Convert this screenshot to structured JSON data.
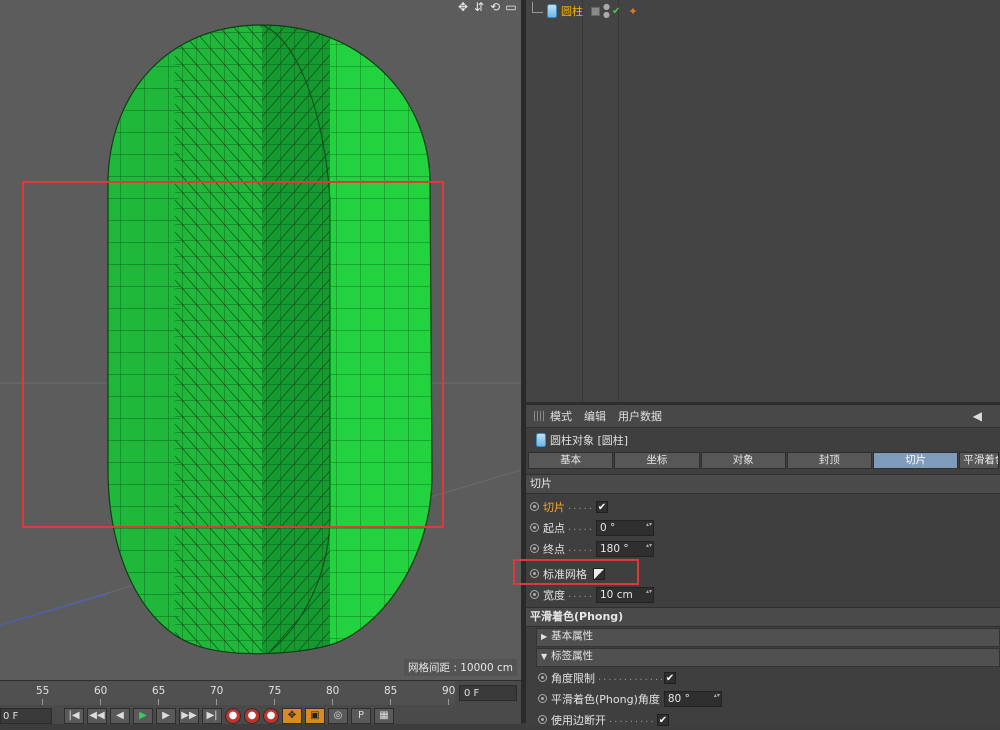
{
  "viewport": {
    "grid_spacing_label": "网格间距 : 10000 cm",
    "nav_icons": [
      "move-view-icon",
      "zoom-view-icon",
      "rotate-view-icon",
      "maximize-view-icon"
    ]
  },
  "timeline": {
    "ticks": [
      "55",
      "60",
      "65",
      "70",
      "75",
      "80",
      "85",
      "90"
    ],
    "current_frame": "0 F",
    "start_frame": "0 F"
  },
  "object_manager": {
    "object_name": "圆柱"
  },
  "attributes": {
    "menu": [
      "模式",
      "编辑",
      "用户数据"
    ],
    "object_title": "圆柱对象 [圆柱]",
    "tabs": [
      "基本",
      "坐标",
      "对象",
      "封顶",
      "切片",
      "平滑着色"
    ],
    "active_tab": "切片",
    "section_slice": "切片",
    "params": {
      "slice_label": "切片",
      "slice_checked": "✔",
      "start_label": "起点",
      "start_value": "0 °",
      "end_label": "终点",
      "end_value": "180 °",
      "std_grid_label": "标准网格",
      "width_label": "宽度",
      "width_value": "10 cm"
    },
    "section_phong": "平滑着色(Phong)",
    "sub_basic": "基本属性",
    "sub_tag": "标签属性",
    "phong_params": {
      "angle_limit_label": "角度限制",
      "angle_limit_checked": "✔",
      "phong_angle_label": "平滑着色(Phong)角度",
      "phong_angle_value": "80 °",
      "use_edge_break_label": "使用边断开",
      "use_edge_break_checked": "✔"
    }
  },
  "colors": {
    "mesh_fill": "#1fb83a",
    "mesh_cut_face": "#22d23e",
    "highlight": "#e0393c",
    "active_tab": "#7f9bbb",
    "object_name": "#f5b400"
  }
}
